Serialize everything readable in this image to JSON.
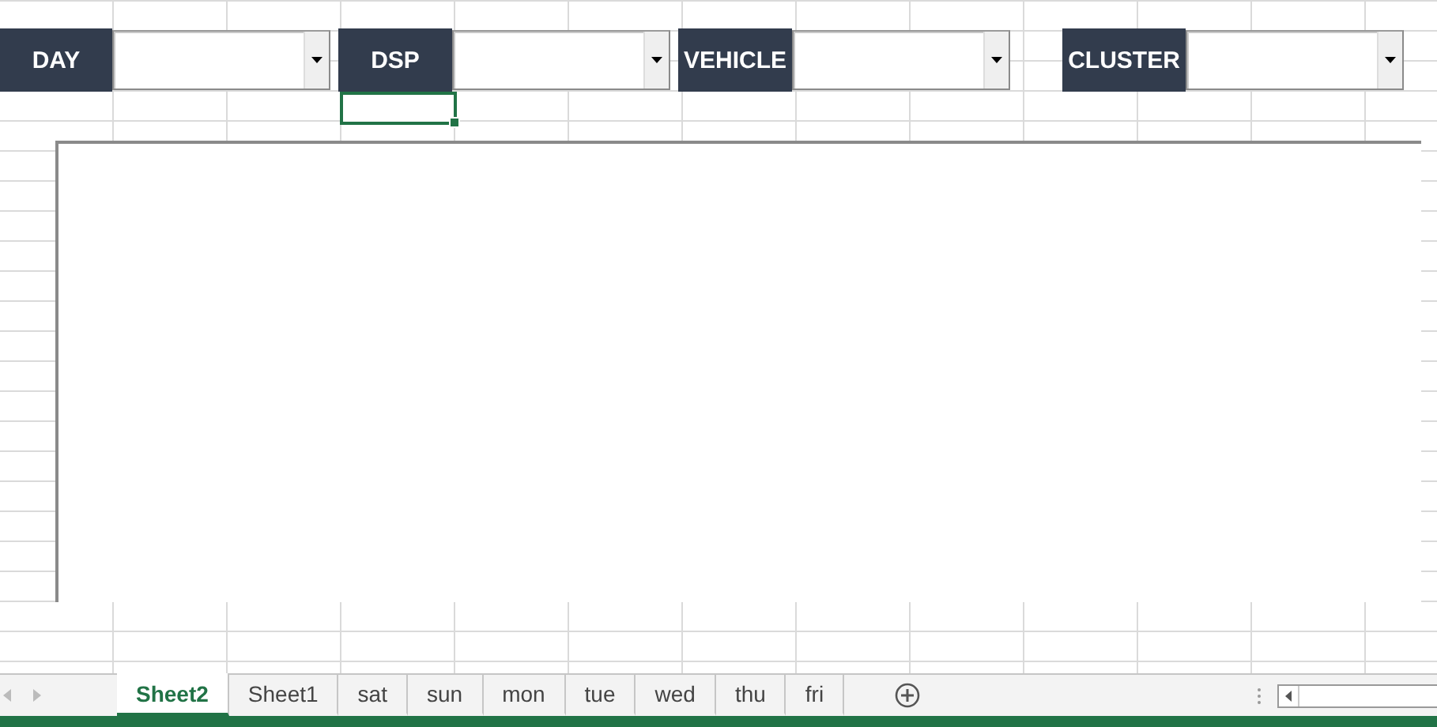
{
  "filters": [
    {
      "label": "DAY"
    },
    {
      "label": "DSP"
    },
    {
      "label": "VEHICLE"
    },
    {
      "label": "CLUSTER"
    }
  ],
  "sheet_tabs": [
    {
      "label": "Sheet2",
      "selected": true
    },
    {
      "label": "Sheet1",
      "selected": false
    },
    {
      "label": "sat",
      "selected": false
    },
    {
      "label": "sun",
      "selected": false
    },
    {
      "label": "mon",
      "selected": false
    },
    {
      "label": "tue",
      "selected": false
    },
    {
      "label": "wed",
      "selected": false
    },
    {
      "label": "thu",
      "selected": false
    },
    {
      "label": "fri",
      "selected": false
    }
  ]
}
